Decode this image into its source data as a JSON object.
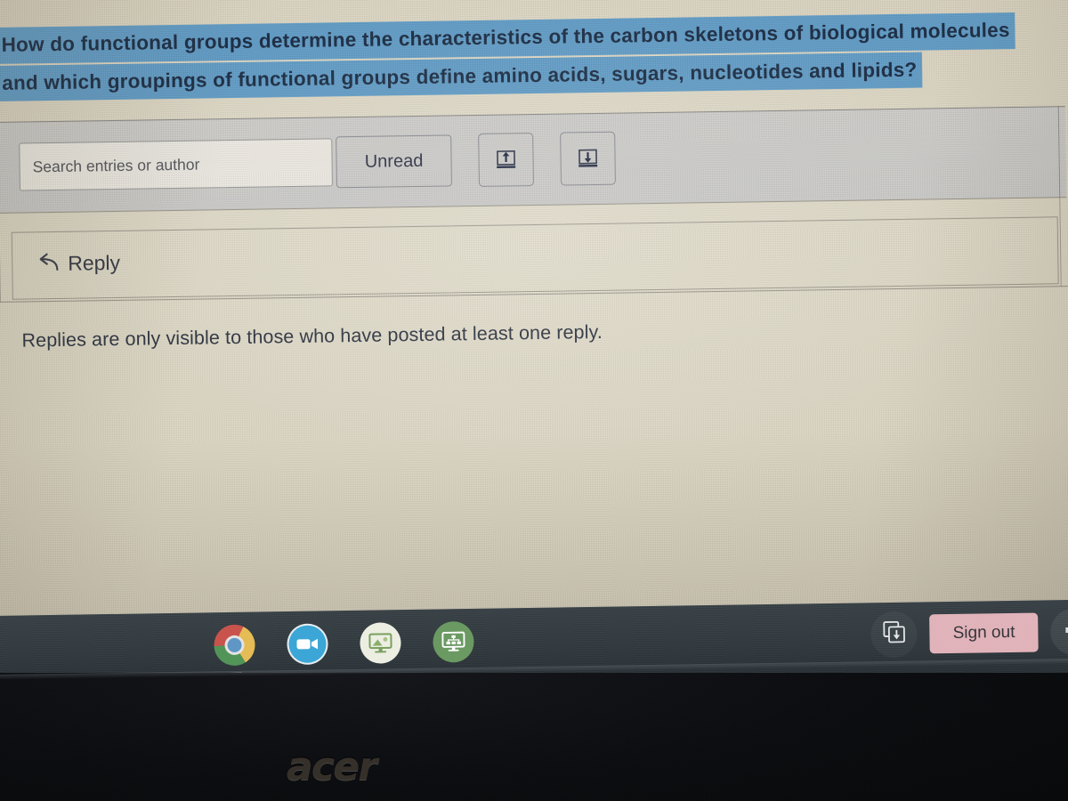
{
  "discussion": {
    "question_line_1": "How do functional groups determine the characteristics of the carbon skeletons of biological molecules",
    "question_line_2": "and which groupings of functional groups define amino acids, sugars, nucleotides and lipids?",
    "highlight_color": "#64a0cb",
    "question_text_color": "#1c2e46",
    "replies_notice": "Replies are only visible to those who have posted at least one reply."
  },
  "toolbar": {
    "search_placeholder": "Search entries or author",
    "search_value": "",
    "unread_label": "Unread",
    "collapse_threads_icon": "arrow-up-to-line-icon",
    "expand_threads_icon": "arrow-down-to-line-icon"
  },
  "reply": {
    "label": "Reply",
    "icon": "reply-arrow-icon"
  },
  "shelf": {
    "apps": [
      {
        "name": "chrome",
        "label": "Google Chrome",
        "active": true
      },
      {
        "name": "zoom",
        "label": "Zoom",
        "active": false
      },
      {
        "name": "monitor-landscape",
        "label": "Classroom Display",
        "active": false
      },
      {
        "name": "monitor-network",
        "label": "Network Monitor",
        "active": false
      }
    ],
    "tray": {
      "capture_icon": "screen-capture-icon",
      "signout_label": "Sign out",
      "signout_color": "#e2b4bb",
      "volume_icon": "volume-icon"
    },
    "background_color": "#333c41"
  },
  "device": {
    "brand": "acer",
    "bezel_color": "#0b0d10"
  }
}
